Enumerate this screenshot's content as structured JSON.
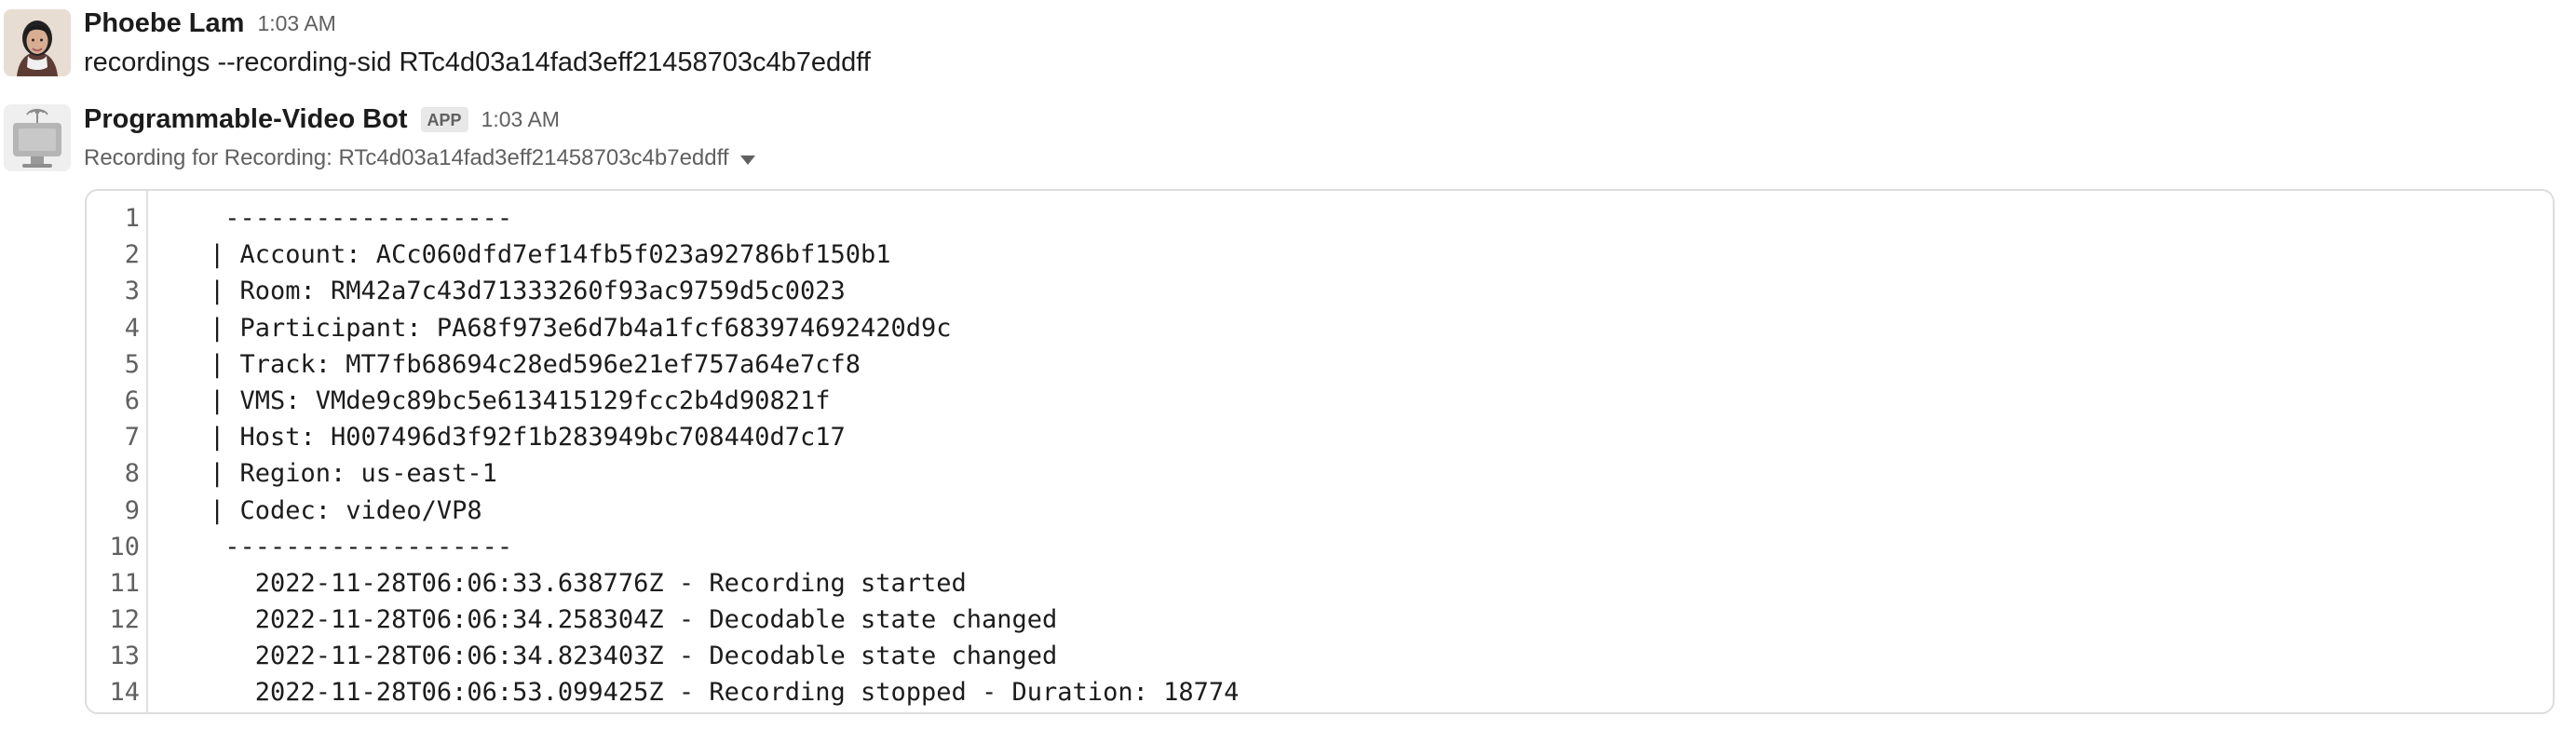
{
  "messages": [
    {
      "author": "Phoebe Lam",
      "time": "1:03 AM",
      "text": "recordings --recording-sid RTc4d03a14fad3eff21458703c4b7eddff"
    },
    {
      "author": "Programmable-Video Bot",
      "badge": "APP",
      "time": "1:03 AM",
      "subtitle": "Recording for Recording: RTc4d03a14fad3eff21458703c4b7eddff"
    }
  ],
  "code_block": {
    "line_numbers": [
      "1",
      "2",
      "3",
      "4",
      "5",
      "6",
      "7",
      "8",
      "9",
      "10",
      "11",
      "12",
      "13",
      "14"
    ],
    "lines": [
      " -------------------",
      "| Account: ACc060dfd7ef14fb5f023a92786bf150b1",
      "| Room: RM42a7c43d71333260f93ac9759d5c0023",
      "| Participant: PA68f973e6d7b4a1fcf683974692420d9c",
      "| Track: MT7fb68694c28ed596e21ef757a64e7cf8",
      "| VMS: VMde9c89bc5e613415129fcc2b4d90821f",
      "| Host: H007496d3f92f1b283949bc708440d7c17",
      "| Region: us-east-1",
      "| Codec: video/VP8",
      " -------------------",
      "   2022-11-28T06:06:33.638776Z - Recording started",
      "   2022-11-28T06:06:34.258304Z - Decodable state changed",
      "   2022-11-28T06:06:34.823403Z - Decodable state changed",
      "   2022-11-28T06:06:53.099425Z - Recording stopped - Duration: 18774"
    ]
  },
  "icons": {
    "user_avatar": "avatar",
    "bot_avatar": "bot-avatar-icon",
    "subtitle_caret": "chevron-down-icon"
  }
}
